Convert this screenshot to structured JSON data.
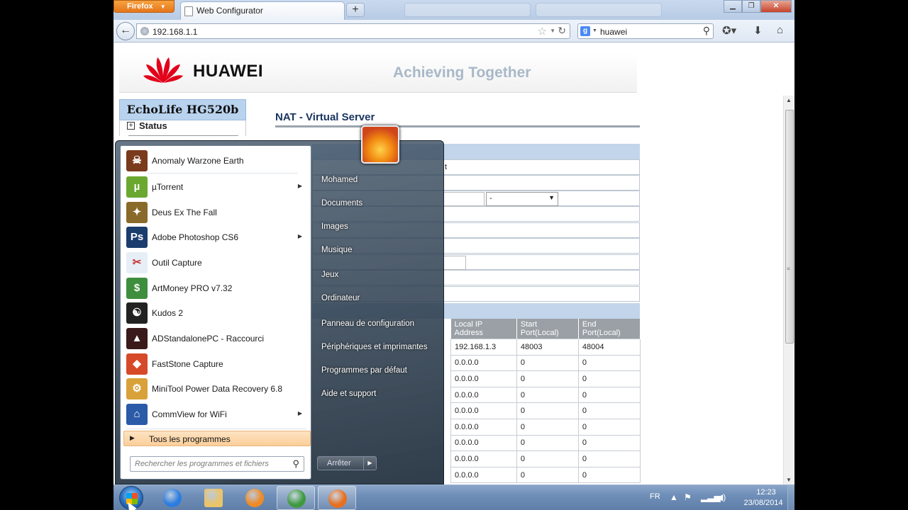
{
  "browser": {
    "app_button": "Firefox",
    "tab_title": "Web Configurator",
    "url": "192.168.1.1",
    "search_query": "huawei"
  },
  "router": {
    "brand": "HUAWEI",
    "slogan": "Achieving Together",
    "model": "EchoLife HG520b",
    "sidebar": [
      {
        "label": "Status"
      }
    ],
    "page_title": "NAT - Virtual Server",
    "row_text": "t",
    "iface_value": "-",
    "table": {
      "headers": [
        [
          "Local IP",
          "Address"
        ],
        [
          "Start",
          "Port(Local)"
        ],
        [
          "End",
          "Port(Local)"
        ]
      ],
      "rows": [
        [
          "192.168.1.3",
          "48003",
          "48004"
        ],
        [
          "0.0.0.0",
          "0",
          "0"
        ],
        [
          "0.0.0.0",
          "0",
          "0"
        ],
        [
          "0.0.0.0",
          "0",
          "0"
        ],
        [
          "0.0.0.0",
          "0",
          "0"
        ],
        [
          "0.0.0.0",
          "0",
          "0"
        ],
        [
          "0.0.0.0",
          "0",
          "0"
        ],
        [
          "0.0.0.0",
          "0",
          "0"
        ],
        [
          "0.0.0.0",
          "0",
          "0"
        ]
      ]
    }
  },
  "start_menu": {
    "programs": [
      {
        "name": "Anomaly Warzone Earth",
        "icon": "anomaly-icon",
        "color": "#7a3a1c",
        "glyph": "☠",
        "submenu": false
      },
      {
        "name": "µTorrent",
        "icon": "utorrent-icon",
        "color": "#6aa82f",
        "glyph": "µ",
        "submenu": true
      },
      {
        "name": "Deus Ex The Fall",
        "icon": "deus-ex-icon",
        "color": "#8a6a2a",
        "glyph": "✦",
        "submenu": false
      },
      {
        "name": "Adobe Photoshop CS6",
        "icon": "photoshop-icon",
        "color": "#1b3d6e",
        "glyph": "Ps",
        "submenu": true
      },
      {
        "name": "Outil Capture",
        "icon": "scissors-icon",
        "color": "#e6eef6",
        "glyph": "✂",
        "submenu": false
      },
      {
        "name": "ArtMoney PRO v7.32",
        "icon": "artmoney-icon",
        "color": "#3e8e3e",
        "glyph": "$",
        "submenu": false
      },
      {
        "name": "Kudos 2",
        "icon": "yin-yang-icon",
        "color": "#222222",
        "glyph": "☯",
        "submenu": false
      },
      {
        "name": "ADStandalonePC - Raccourci",
        "icon": "assassin-icon",
        "color": "#3a1a1a",
        "glyph": "▲",
        "submenu": false
      },
      {
        "name": "FastStone Capture",
        "icon": "faststone-icon",
        "color": "#d64a2a",
        "glyph": "◆",
        "submenu": false
      },
      {
        "name": "MiniTool Power Data Recovery 6.8",
        "icon": "minitool-icon",
        "color": "#d9a13a",
        "glyph": "⚙",
        "submenu": false
      },
      {
        "name": "CommView for WiFi",
        "icon": "commview-icon",
        "color": "#2a5aa8",
        "glyph": "⌂",
        "submenu": true
      }
    ],
    "all_programs": "Tous les programmes",
    "search_placeholder": "Rechercher les programmes et fichiers",
    "places": [
      "Mohamed",
      "Documents",
      "Images",
      "Musique",
      "Jeux",
      "Ordinateur",
      "Panneau de configuration",
      "Périphériques et imprimantes",
      "Programmes par défaut",
      "Aide et support"
    ],
    "shutdown": "Arrêter"
  },
  "taskbar": {
    "language": "FR",
    "time": "12:23",
    "date": "23/08/2014",
    "apps": [
      {
        "name": "ie-icon",
        "color": "#2b7de0",
        "running": false
      },
      {
        "name": "explorer-folder-icon",
        "color": "#e9c46a",
        "running": false
      },
      {
        "name": "media-player-icon",
        "color": "#f08a24",
        "running": false
      },
      {
        "name": "chrome-icon",
        "color": "#3f9a3f",
        "running": true
      },
      {
        "name": "firefox-icon",
        "color": "#e76f1e",
        "running": true
      }
    ]
  }
}
